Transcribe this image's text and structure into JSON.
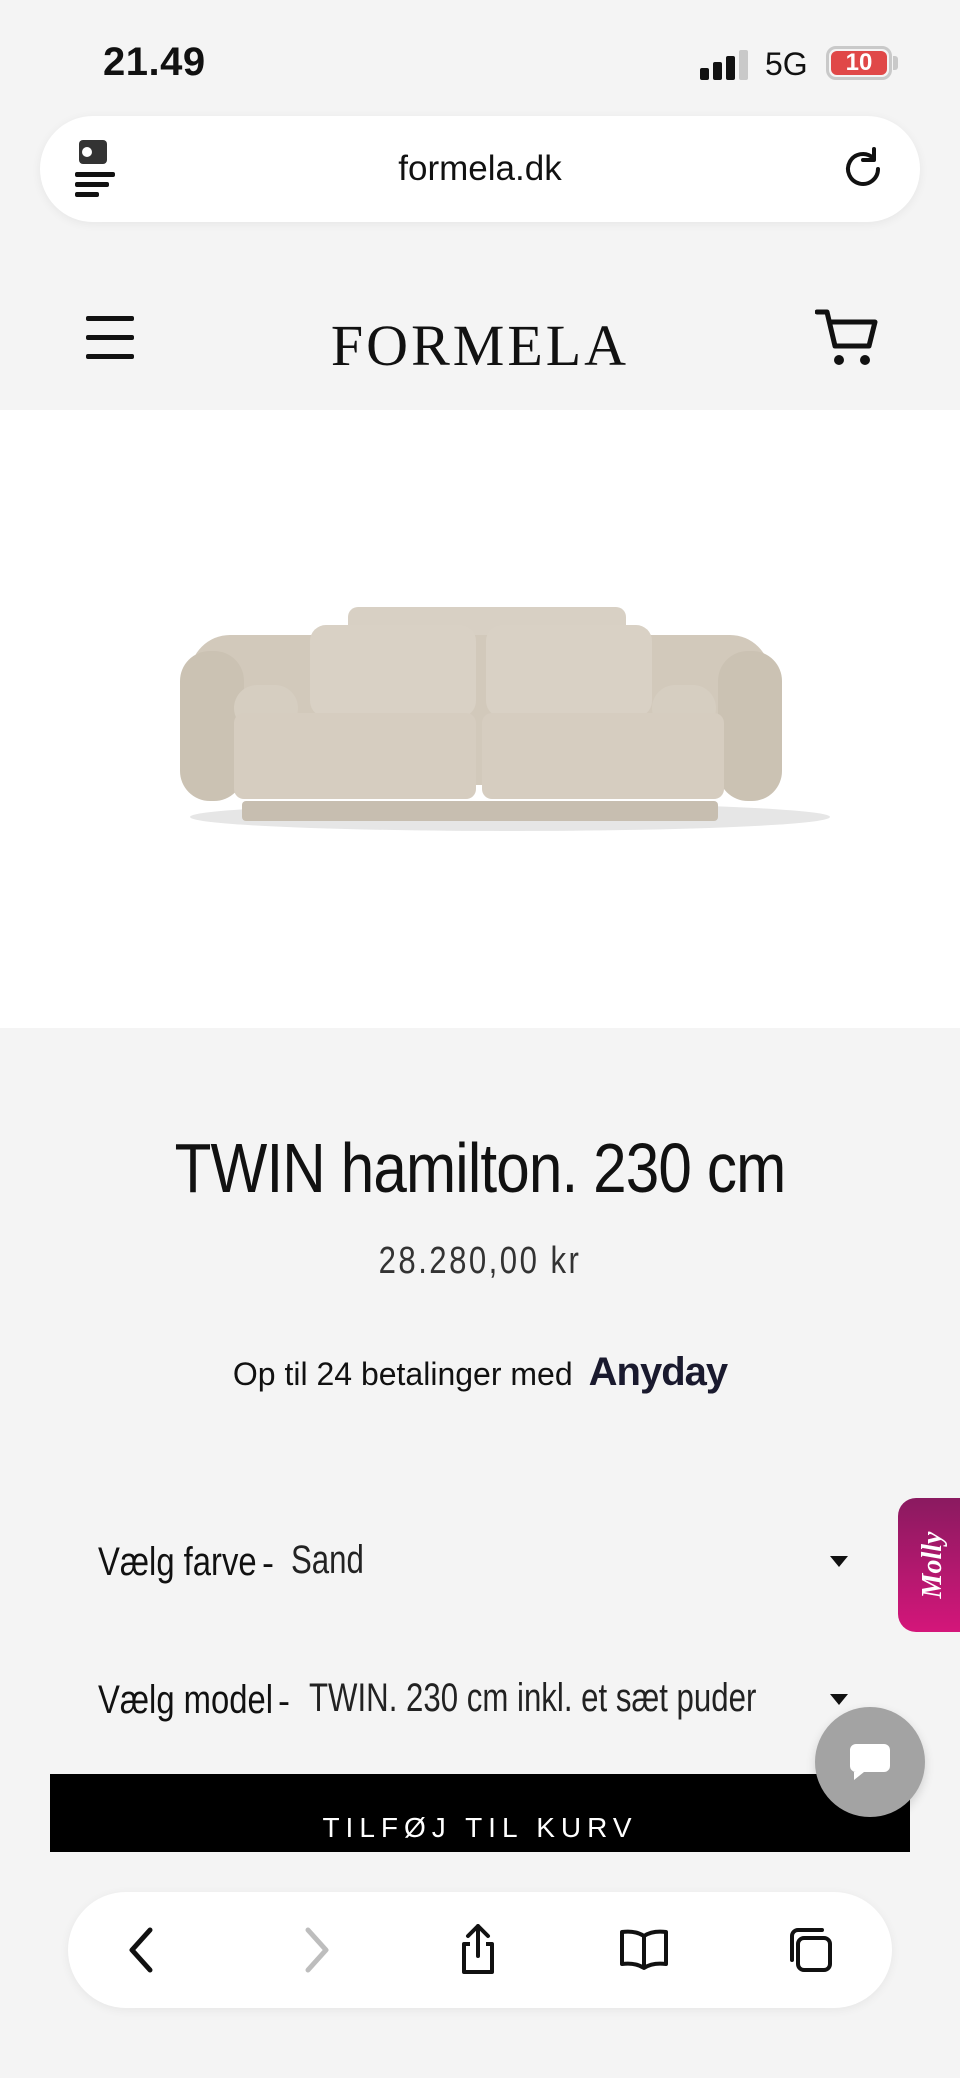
{
  "status_bar": {
    "time": "21.49",
    "network": "5G",
    "battery": "10"
  },
  "browser": {
    "url": "formela.dk"
  },
  "header": {
    "logo": "FORMELA"
  },
  "product": {
    "title": "TWIN hamilton. 230 cm",
    "price": "28.280,00 kr",
    "installments_text": "Op til 24 betalinger med",
    "installments_brand": "Anyday"
  },
  "options": {
    "color_label": "Vælg farve",
    "color_value": "Sand",
    "model_label": "Vælg model",
    "model_value": "TWIN. 230 cm inkl. et sæt puder",
    "separator": "-"
  },
  "actions": {
    "add_to_cart": "TILFØJ TIL KURV"
  },
  "widgets": {
    "molly": "Molly"
  },
  "colors": {
    "accent": "#000000",
    "molly_gradient_top": "#8a1a60",
    "molly_gradient_bottom": "#d4167a",
    "battery_low": "#e04848",
    "sofa": "#cfc6b8"
  }
}
